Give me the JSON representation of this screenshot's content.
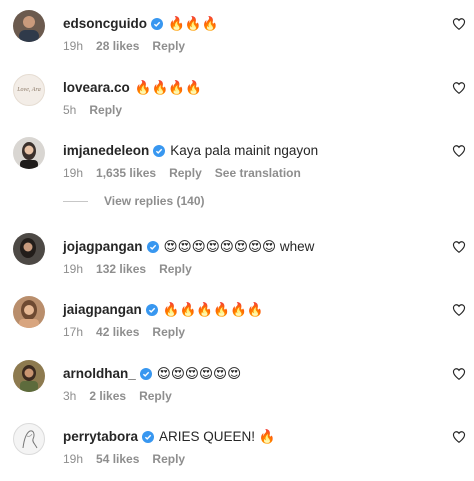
{
  "comments": [
    {
      "username": "edsoncguido",
      "verified": true,
      "text": "🔥🔥🔥",
      "time": "19h",
      "likes": "28 likes",
      "reply": "Reply",
      "translation": ""
    },
    {
      "username": "loveara.co",
      "verified": false,
      "text": "🔥🔥🔥🔥",
      "time": "5h",
      "likes": "",
      "reply": "Reply",
      "translation": "",
      "avatar_text": "Love, Ara"
    },
    {
      "username": "imjanedeleon",
      "verified": true,
      "text": "Kaya pala mainit ngayon",
      "time": "19h",
      "likes": "1,635 likes",
      "reply": "Reply",
      "translation": "See translation"
    },
    {
      "username": "jojagpangan",
      "verified": true,
      "text": "😍😍😍😍😍😍😍😍 whew",
      "time": "19h",
      "likes": "132 likes",
      "reply": "Reply",
      "translation": ""
    },
    {
      "username": "jaiagpangan",
      "verified": true,
      "text": "🔥🔥🔥🔥🔥🔥",
      "time": "17h",
      "likes": "42 likes",
      "reply": "Reply",
      "translation": ""
    },
    {
      "username": "arnoldhan_",
      "verified": true,
      "text": "😍😍😍😍😍😍",
      "time": "3h",
      "likes": "2 likes",
      "reply": "Reply",
      "translation": ""
    },
    {
      "username": "perrytabora",
      "verified": true,
      "text": "ARIES QUEEN! 🔥",
      "time": "19h",
      "likes": "54 likes",
      "reply": "Reply",
      "translation": ""
    }
  ],
  "view_replies": "View replies (140)",
  "colors": {
    "verified": "#3897f0",
    "secondary_text": "#8e8e8e",
    "primary_text": "#262626"
  },
  "icons": {
    "like": "heart-outline-icon",
    "verified": "verified-badge-icon"
  }
}
